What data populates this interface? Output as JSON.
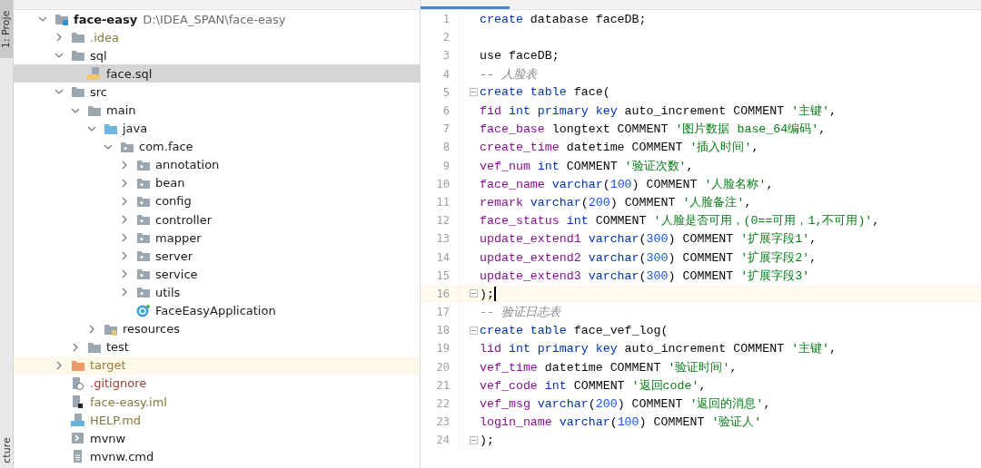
{
  "side_rail": {
    "top_tab": "1: Proje",
    "bottom_tab": "cture"
  },
  "tree": [
    {
      "name": "face-easy",
      "path": "D:\\IDEA_SPAN\\face-easy",
      "kind": "module",
      "expanded": true,
      "selected": false,
      "color": "#1a1a1a",
      "children": [
        {
          "name": ".idea",
          "kind": "folder",
          "expanded": false,
          "selected": false,
          "color": "#827a3c"
        },
        {
          "name": "sql",
          "kind": "folder",
          "expanded": true,
          "selected": false,
          "color": "#1a1a1a",
          "children": [
            {
              "name": "face.sql",
              "kind": "sql",
              "selected": true,
              "color": "#1a1a1a"
            }
          ]
        },
        {
          "name": "src",
          "kind": "folder",
          "expanded": true,
          "selected": false,
          "color": "#1a1a1a",
          "children": [
            {
              "name": "main",
              "kind": "folder",
              "expanded": true,
              "selected": false,
              "color": "#1a1a1a",
              "children": [
                {
                  "name": "java",
                  "kind": "source",
                  "expanded": true,
                  "selected": false,
                  "color": "#1a1a1a",
                  "children": [
                    {
                      "name": "com.face",
                      "kind": "package",
                      "expanded": true,
                      "selected": false,
                      "color": "#1a1a1a",
                      "children": [
                        {
                          "name": "annotation",
                          "kind": "package",
                          "expanded": false,
                          "selected": false,
                          "color": "#1a1a1a"
                        },
                        {
                          "name": "bean",
                          "kind": "package",
                          "expanded": false,
                          "selected": false,
                          "color": "#1a1a1a"
                        },
                        {
                          "name": "config",
                          "kind": "package",
                          "expanded": false,
                          "selected": false,
                          "color": "#1a1a1a"
                        },
                        {
                          "name": "controller",
                          "kind": "package",
                          "expanded": false,
                          "selected": false,
                          "color": "#1a1a1a"
                        },
                        {
                          "name": "mapper",
                          "kind": "package",
                          "expanded": false,
                          "selected": false,
                          "color": "#1a1a1a"
                        },
                        {
                          "name": "server",
                          "kind": "package",
                          "expanded": false,
                          "selected": false,
                          "color": "#1a1a1a"
                        },
                        {
                          "name": "service",
                          "kind": "package",
                          "expanded": false,
                          "selected": false,
                          "color": "#1a1a1a"
                        },
                        {
                          "name": "utils",
                          "kind": "package",
                          "expanded": false,
                          "selected": false,
                          "color": "#1a1a1a"
                        },
                        {
                          "name": "FaceEasyApplication",
                          "kind": "class",
                          "selected": false,
                          "color": "#1a1a1a"
                        }
                      ]
                    }
                  ]
                },
                {
                  "name": "resources",
                  "kind": "resources",
                  "expanded": false,
                  "selected": false,
                  "color": "#1a1a1a"
                }
              ]
            },
            {
              "name": "test",
              "kind": "folder",
              "expanded": false,
              "selected": false,
              "color": "#1a1a1a"
            }
          ]
        },
        {
          "name": "target",
          "kind": "excluded",
          "expanded": false,
          "selected": false,
          "color": "#a07a3a"
        },
        {
          "name": ".gitignore",
          "kind": "ignorefile",
          "selected": false,
          "color": "#9b3d2b"
        },
        {
          "name": "face-easy.iml",
          "kind": "iml",
          "selected": false,
          "color": "#827a3c"
        },
        {
          "name": "HELP.md",
          "kind": "md",
          "selected": false,
          "color": "#827a3c"
        },
        {
          "name": "mvnw",
          "kind": "script",
          "selected": false,
          "color": "#1a1a1a"
        },
        {
          "name": "mvnw.cmd",
          "kind": "text",
          "selected": false,
          "color": "#1a1a1a"
        }
      ]
    }
  ],
  "editor": {
    "lines": [
      {
        "number": "1",
        "current": false,
        "tokens": [
          {
            "kind": "keyword",
            "text": "create"
          },
          {
            "kind": "plain",
            "text": " database faceDB;"
          }
        ]
      },
      {
        "number": "2",
        "current": false
      },
      {
        "number": "3",
        "current": false,
        "tokens": [
          {
            "kind": "plain",
            "text": "use faceDB;"
          }
        ]
      },
      {
        "number": "4",
        "current": false,
        "tokens": [
          {
            "kind": "comment",
            "text": "-- 人脸表"
          }
        ]
      },
      {
        "number": "5",
        "current": false,
        "fold": true,
        "tokens": [
          {
            "kind": "keyword",
            "text": "create table"
          },
          {
            "kind": "plain",
            "text": " face("
          }
        ]
      },
      {
        "number": "6",
        "current": false,
        "tokens": [
          {
            "kind": "field",
            "text": "fid"
          },
          {
            "kind": "keyword",
            "text": " int primary key"
          },
          {
            "kind": "plain",
            "text": " auto_increment COMMENT "
          },
          {
            "kind": "string",
            "text": "'主键'"
          },
          {
            "kind": "plain",
            "text": ","
          }
        ]
      },
      {
        "number": "7",
        "current": false,
        "tokens": [
          {
            "kind": "field",
            "text": "face_base"
          },
          {
            "kind": "plain",
            "text": " longtext COMMENT "
          },
          {
            "kind": "string",
            "text": "'图片数据 base_64编码'"
          },
          {
            "kind": "plain",
            "text": ","
          }
        ]
      },
      {
        "number": "8",
        "current": false,
        "tokens": [
          {
            "kind": "field",
            "text": "create_time"
          },
          {
            "kind": "plain",
            "text": " datetime COMMENT "
          },
          {
            "kind": "string",
            "text": "'插入时间'"
          },
          {
            "kind": "plain",
            "text": ","
          }
        ]
      },
      {
        "number": "9",
        "current": false,
        "tokens": [
          {
            "kind": "field",
            "text": "vef_num"
          },
          {
            "kind": "keyword",
            "text": " int"
          },
          {
            "kind": "plain",
            "text": " COMMENT "
          },
          {
            "kind": "string",
            "text": "'验证次数'"
          },
          {
            "kind": "plain",
            "text": ","
          }
        ]
      },
      {
        "number": "10",
        "current": false,
        "tokens": [
          {
            "kind": "field",
            "text": "face_name"
          },
          {
            "kind": "keyword",
            "text": " varchar"
          },
          {
            "kind": "plain",
            "text": "("
          },
          {
            "kind": "number",
            "text": "100"
          },
          {
            "kind": "plain",
            "text": ") COMMENT "
          },
          {
            "kind": "string",
            "text": "'人脸名称'"
          },
          {
            "kind": "plain",
            "text": ","
          }
        ]
      },
      {
        "number": "11",
        "current": false,
        "tokens": [
          {
            "kind": "field",
            "text": "remark"
          },
          {
            "kind": "keyword",
            "text": " varchar"
          },
          {
            "kind": "plain",
            "text": "("
          },
          {
            "kind": "number",
            "text": "200"
          },
          {
            "kind": "plain",
            "text": ") COMMENT "
          },
          {
            "kind": "string",
            "text": "'人脸备注'"
          },
          {
            "kind": "plain",
            "text": ","
          }
        ]
      },
      {
        "number": "12",
        "current": false,
        "tokens": [
          {
            "kind": "field",
            "text": "face_status"
          },
          {
            "kind": "keyword",
            "text": " int"
          },
          {
            "kind": "plain",
            "text": " COMMENT "
          },
          {
            "kind": "string",
            "text": "'人脸是否可用，(0==可用，1,不可用)'"
          },
          {
            "kind": "plain",
            "text": ","
          }
        ]
      },
      {
        "number": "13",
        "current": false,
        "tokens": [
          {
            "kind": "field",
            "text": "update_extend1"
          },
          {
            "kind": "keyword",
            "text": " varchar"
          },
          {
            "kind": "plain",
            "text": "("
          },
          {
            "kind": "number",
            "text": "300"
          },
          {
            "kind": "plain",
            "text": ") COMMENT "
          },
          {
            "kind": "string",
            "text": "'扩展字段1'"
          },
          {
            "kind": "plain",
            "text": ","
          }
        ]
      },
      {
        "number": "14",
        "current": false,
        "tokens": [
          {
            "kind": "field",
            "text": "update_extend2"
          },
          {
            "kind": "keyword",
            "text": " varchar"
          },
          {
            "kind": "plain",
            "text": "("
          },
          {
            "kind": "number",
            "text": "300"
          },
          {
            "kind": "plain",
            "text": ") COMMENT "
          },
          {
            "kind": "string",
            "text": "'扩展字段2'"
          },
          {
            "kind": "plain",
            "text": ","
          }
        ]
      },
      {
        "number": "15",
        "current": false,
        "tokens": [
          {
            "kind": "field",
            "text": "update_extend3"
          },
          {
            "kind": "keyword",
            "text": " varchar"
          },
          {
            "kind": "plain",
            "text": "("
          },
          {
            "kind": "number",
            "text": "300"
          },
          {
            "kind": "plain",
            "text": ") COMMENT "
          },
          {
            "kind": "string",
            "text": "'扩展字段3'"
          }
        ]
      },
      {
        "number": "16",
        "current": true,
        "fold": true,
        "tokens": [
          {
            "kind": "plain",
            "text": ");"
          }
        ]
      },
      {
        "number": "17",
        "current": false,
        "tokens": [
          {
            "kind": "comment",
            "text": "-- 验证日志表"
          }
        ]
      },
      {
        "number": "18",
        "current": false,
        "fold": true,
        "tokens": [
          {
            "kind": "keyword",
            "text": "create table"
          },
          {
            "kind": "plain",
            "text": " face_vef_log("
          }
        ]
      },
      {
        "number": "19",
        "current": false,
        "tokens": [
          {
            "kind": "field",
            "text": "lid"
          },
          {
            "kind": "keyword",
            "text": " int primary key"
          },
          {
            "kind": "plain",
            "text": " auto_increment COMMENT "
          },
          {
            "kind": "string",
            "text": "'主键'"
          },
          {
            "kind": "plain",
            "text": ","
          }
        ]
      },
      {
        "number": "20",
        "current": false,
        "tokens": [
          {
            "kind": "field",
            "text": "vef_time"
          },
          {
            "kind": "plain",
            "text": " datetime COMMENT "
          },
          {
            "kind": "string",
            "text": "'验证时间'"
          },
          {
            "kind": "plain",
            "text": ","
          }
        ]
      },
      {
        "number": "21",
        "current": false,
        "tokens": [
          {
            "kind": "field",
            "text": "vef_code"
          },
          {
            "kind": "keyword",
            "text": " int"
          },
          {
            "kind": "plain",
            "text": " COMMENT "
          },
          {
            "kind": "string",
            "text": "'返回code'"
          },
          {
            "kind": "plain",
            "text": ","
          }
        ]
      },
      {
        "number": "22",
        "current": false,
        "tokens": [
          {
            "kind": "field",
            "text": "vef_msg"
          },
          {
            "kind": "keyword",
            "text": " varchar"
          },
          {
            "kind": "plain",
            "text": "("
          },
          {
            "kind": "number",
            "text": "200"
          },
          {
            "kind": "plain",
            "text": ") COMMENT "
          },
          {
            "kind": "string",
            "text": "'返回的消息'"
          },
          {
            "kind": "plain",
            "text": ","
          }
        ]
      },
      {
        "number": "23",
        "current": false,
        "tokens": [
          {
            "kind": "field",
            "text": "login_name"
          },
          {
            "kind": "keyword",
            "text": " varchar"
          },
          {
            "kind": "plain",
            "text": "("
          },
          {
            "kind": "number",
            "text": "100"
          },
          {
            "kind": "plain",
            "text": ") COMMENT "
          },
          {
            "kind": "string",
            "text": "'验证人'"
          }
        ]
      },
      {
        "number": "24",
        "current": false,
        "fold": true,
        "tokens": [
          {
            "kind": "plain",
            "text": ");"
          }
        ]
      }
    ]
  }
}
